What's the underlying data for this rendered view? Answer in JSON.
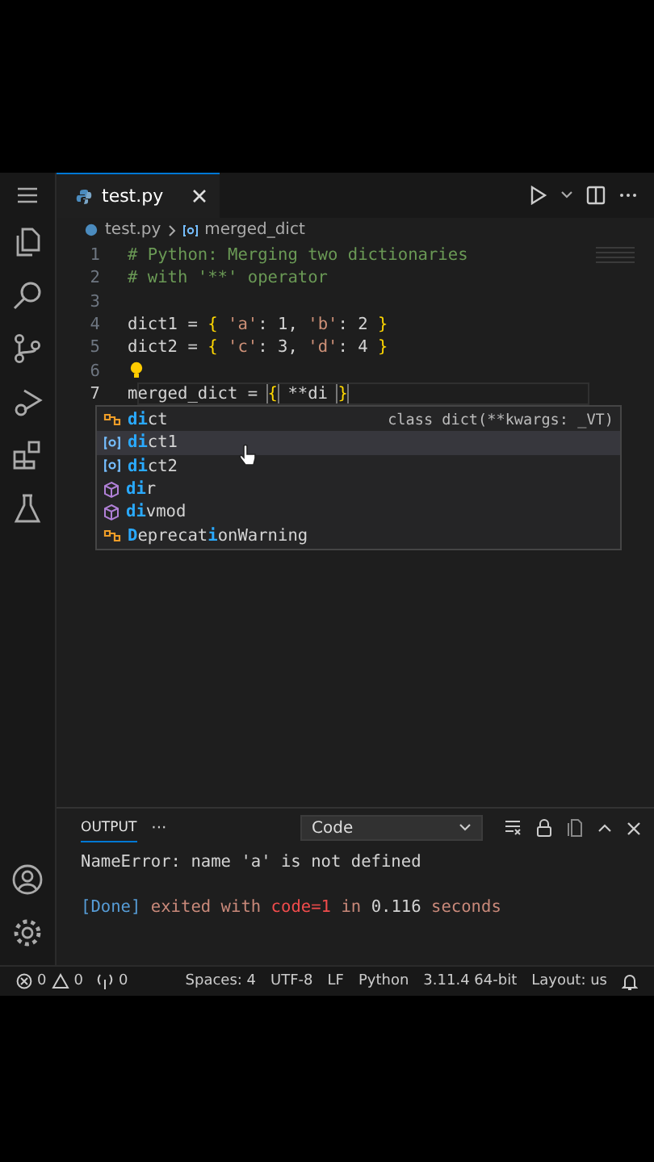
{
  "tabs": [
    {
      "label": "test.py",
      "selected": true
    }
  ],
  "breadcrumb": {
    "file": "test.py",
    "symbol": "merged_dict"
  },
  "code_lines": [
    {
      "number": "1",
      "tokens": [
        {
          "kind": "comment",
          "text": "# Python: Merging two dictionaries"
        }
      ]
    },
    {
      "number": "2",
      "tokens": [
        {
          "kind": "comment",
          "text": "# with '**' operator"
        }
      ]
    },
    {
      "number": "3"
    },
    {
      "number": "4",
      "tokens": [
        {
          "kind": "plain",
          "text": "dict1 = "
        },
        {
          "kind": "brace",
          "text": "{"
        },
        {
          "kind": "string",
          "text": " 'a'"
        },
        {
          "kind": "plain",
          "text": ": 1, "
        },
        {
          "kind": "string",
          "text": "'b'"
        },
        {
          "kind": "plain",
          "text": ": 2 "
        },
        {
          "kind": "brace",
          "text": "}"
        }
      ]
    },
    {
      "number": "5",
      "tokens": [
        {
          "kind": "plain",
          "text": "dict2 = "
        },
        {
          "kind": "brace",
          "text": "{"
        },
        {
          "kind": "string",
          "text": " 'c'"
        },
        {
          "kind": "plain",
          "text": ": 3, "
        },
        {
          "kind": "string",
          "text": "'d'"
        },
        {
          "kind": "plain",
          "text": ": 4 "
        },
        {
          "kind": "brace",
          "text": "}"
        }
      ]
    },
    {
      "number": "6",
      "lightbulb": true
    },
    {
      "number": "7",
      "tokens": [
        {
          "kind": "plain",
          "text": "merged_dict = "
        },
        {
          "kind": "brace-match",
          "text": "{"
        },
        {
          "kind": "plain",
          "text": " **di "
        },
        {
          "kind": "brace-match",
          "text": "}"
        }
      ],
      "current": true
    }
  ],
  "suggestions": [
    {
      "kind": "class",
      "parts": [
        {
          "text": "di",
          "match": true
        },
        {
          "text": "ct",
          "match": false
        }
      ],
      "detail": "class dict(**kwargs: _VT)",
      "selected": false
    },
    {
      "kind": "variable",
      "parts": [
        {
          "text": "di",
          "match": true
        },
        {
          "text": "ct1",
          "match": false
        }
      ],
      "selected": true
    },
    {
      "kind": "variable",
      "parts": [
        {
          "text": "di",
          "match": true
        },
        {
          "text": "ct2",
          "match": false
        }
      ],
      "selected": false
    },
    {
      "kind": "function",
      "parts": [
        {
          "text": "di",
          "match": true
        },
        {
          "text": "r",
          "match": false
        }
      ],
      "selected": false
    },
    {
      "kind": "function",
      "parts": [
        {
          "text": "di",
          "match": true
        },
        {
          "text": "vmod",
          "match": false
        }
      ],
      "selected": false
    },
    {
      "kind": "class",
      "parts": [
        {
          "text": "D",
          "match": true
        },
        {
          "text": "eprecat",
          "match": false
        },
        {
          "text": "i",
          "match": true
        },
        {
          "text": "onWarning",
          "match": false
        }
      ],
      "selected": false
    }
  ],
  "panel": {
    "tab": "OUTPUT",
    "more": "···",
    "channel": "Code",
    "lines": [
      {
        "blank_line_before": false,
        "segments": [
          {
            "kind": "plain",
            "text": "NameError: name 'a' is not defined"
          }
        ]
      },
      {
        "blank_line_before": true,
        "segments": [
          {
            "kind": "info",
            "text": "[Done]"
          },
          {
            "kind": "dim",
            "text": " exited with "
          },
          {
            "kind": "error",
            "text": "code=1"
          },
          {
            "kind": "dim",
            "text": " in "
          },
          {
            "kind": "plain",
            "text": "0.116"
          },
          {
            "kind": "dim",
            "text": " seconds"
          }
        ]
      }
    ]
  },
  "status_bar": {
    "errors": "0",
    "warnings": "0",
    "ports": "0",
    "items": [
      "Spaces: 4",
      "UTF-8",
      "LF",
      "Python",
      "3.11.4 64-bit",
      "Layout: us"
    ]
  }
}
